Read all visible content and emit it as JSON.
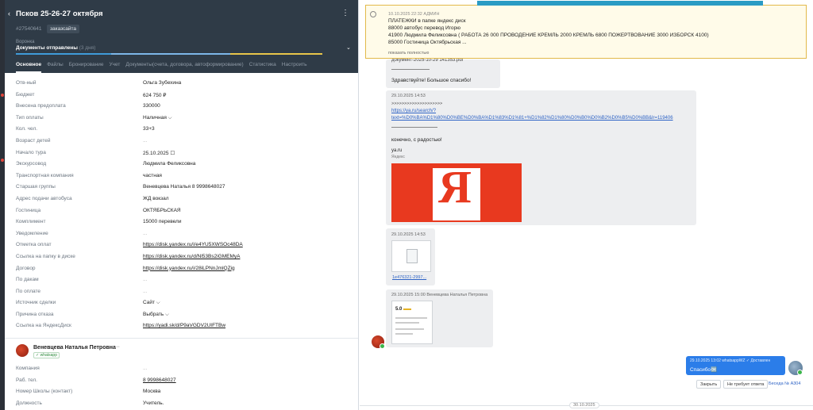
{
  "deal": {
    "back_icon": "chevron-left-icon",
    "title": "Псков 25-26-27 октября",
    "id": "#27540641",
    "tag": "заказсайта",
    "funnel_label": "Воронка",
    "stage": "Документы отправлены",
    "stage_days": "(3 дня)"
  },
  "tabs": [
    {
      "label": "Основное",
      "active": true
    },
    {
      "label": "Файлы"
    },
    {
      "label": "Бронирование"
    },
    {
      "label": "Учет"
    },
    {
      "label": "Документы(счета, договора, автоформирование)"
    },
    {
      "label": "Статистика"
    },
    {
      "label": "Настроить"
    }
  ],
  "fields": [
    {
      "label": "Отв-ный",
      "value": "Ольга Зубехина"
    },
    {
      "label": "Бюджет",
      "value": "624 750 ₽"
    },
    {
      "label": "Внесена предоплата",
      "value": "330000"
    },
    {
      "label": "Тип оплаты",
      "value": "Наличная ⌵"
    },
    {
      "label": "Кол. чел.",
      "value": "33+3"
    },
    {
      "label": "Возраст детей",
      "value": "..."
    },
    {
      "label": "Начало тура",
      "value": "25.10.2025 ☐"
    },
    {
      "label": "Экскурсовод",
      "value": "Людмила Феликсовна"
    },
    {
      "label": "Транспортная компания",
      "value": "частная"
    },
    {
      "label": "Старшая группы",
      "value": "Веневцева Наталья 8 9998648027"
    },
    {
      "label": "Адрес подачи автобуса",
      "value": "ЖД вокзал"
    },
    {
      "label": "Гостиница",
      "value": "ОКТЯБРЬСКАЯ"
    },
    {
      "label": "Комплимент",
      "value": "15000 перевели"
    },
    {
      "label": "Уведомление",
      "value": "..."
    },
    {
      "label": "Отметка оплат",
      "value": "https://disk.yandex.ru/i/e4YU5XWSOc48DA",
      "link": true
    },
    {
      "label": "Ссылка на папку в диске",
      "value": "https://disk.yandex.ru/d/Nl53Bs2iGMEMyA",
      "link": true
    },
    {
      "label": "Договор",
      "value": "https://disk.yandex.ru/i/28iLPNnJmlQZig",
      "link": true
    },
    {
      "label": "По дакам",
      "value": "..."
    },
    {
      "label": "По оплате",
      "value": "..."
    },
    {
      "label": "Источник сделки",
      "value": "Сайт ⌵"
    },
    {
      "label": "Причина отказа",
      "value": "Выбрать ⌵"
    },
    {
      "label": "Ссылка на ЯндексДиск",
      "value": "https://yadi.sk/d/P9aVGDV2UIFTBw",
      "link": true
    }
  ],
  "contact": {
    "name": "Веневцева Наталья Петровна",
    "more": "···",
    "badge": "✓ whatsapp",
    "fields": [
      {
        "label": "Компания",
        "value": "..."
      },
      {
        "label": "Раб. тел.",
        "value": "8 9998648027",
        "link": true
      },
      {
        "label": "Номер Школы (контакт)",
        "value": "Москва"
      },
      {
        "label": "Должность",
        "value": "Учитель."
      }
    ]
  },
  "pinned": {
    "meta": "10.10.2025 22:32 АДМИН",
    "lines": [
      "ПЛАТЕЖКИ в папке яндекс диск",
      "88000 автобус перевод Игорю",
      "41900 Людмила Феликсовна ( РАБОТА 26 000 ПРОВОДЕНИЕ КРЕМЛЬ 2000 КРЕМЛЬ 6800 ПОЖЕРТВОВАНИЕ 3000 ИЗБОРСК 4100)",
      "85000 Гостиница Октябрьская ..."
    ],
    "more": "показать полностью"
  },
  "messages": {
    "m1_file": "документ-2025-10-29 141353.pdf",
    "m1_text": "Здравствуйте! Большое спасибо!",
    "m2_time": "29.10.2025 14:53",
    "m2_arrows": ">>>>>>>>>>>>>>>>>>>>",
    "m2_url1": "https://ya.ru/search/?",
    "m2_url2": "text=%D0%BA%D1%80%D0%BE%D0%BA%D1%83%D1%81+%D1%82%D1%80%D0%B0%D0%B2%D0%B5%D0%BB&lr=119406",
    "m2_text": "конечно, с радостью!",
    "m2_site": "ya.ru",
    "m2_site2": "Яндекс",
    "m2_logo": "Я",
    "m3_time": "29.10.2025 14:53",
    "m3_file": "1e476321-2997...",
    "m4_time": "29.10.2025 15:00 Веневцева Наталья Петровна",
    "m4_score": "5.0",
    "out_meta": "29.10.2025 13:02 whatsappWZ ✓ Доставлен",
    "out_text": "Спасибо🆗"
  },
  "actions": {
    "close": "Закрыть",
    "no_reply": "Не требует ответа",
    "conversation": "Беседа № А304"
  },
  "date_divider": "30.10.2025",
  "colors": {
    "header_bg": "#2f3b47",
    "accent": "#2b7de9",
    "pinned_bg": "#fffbe9",
    "yandex_red": "#e8391f"
  }
}
